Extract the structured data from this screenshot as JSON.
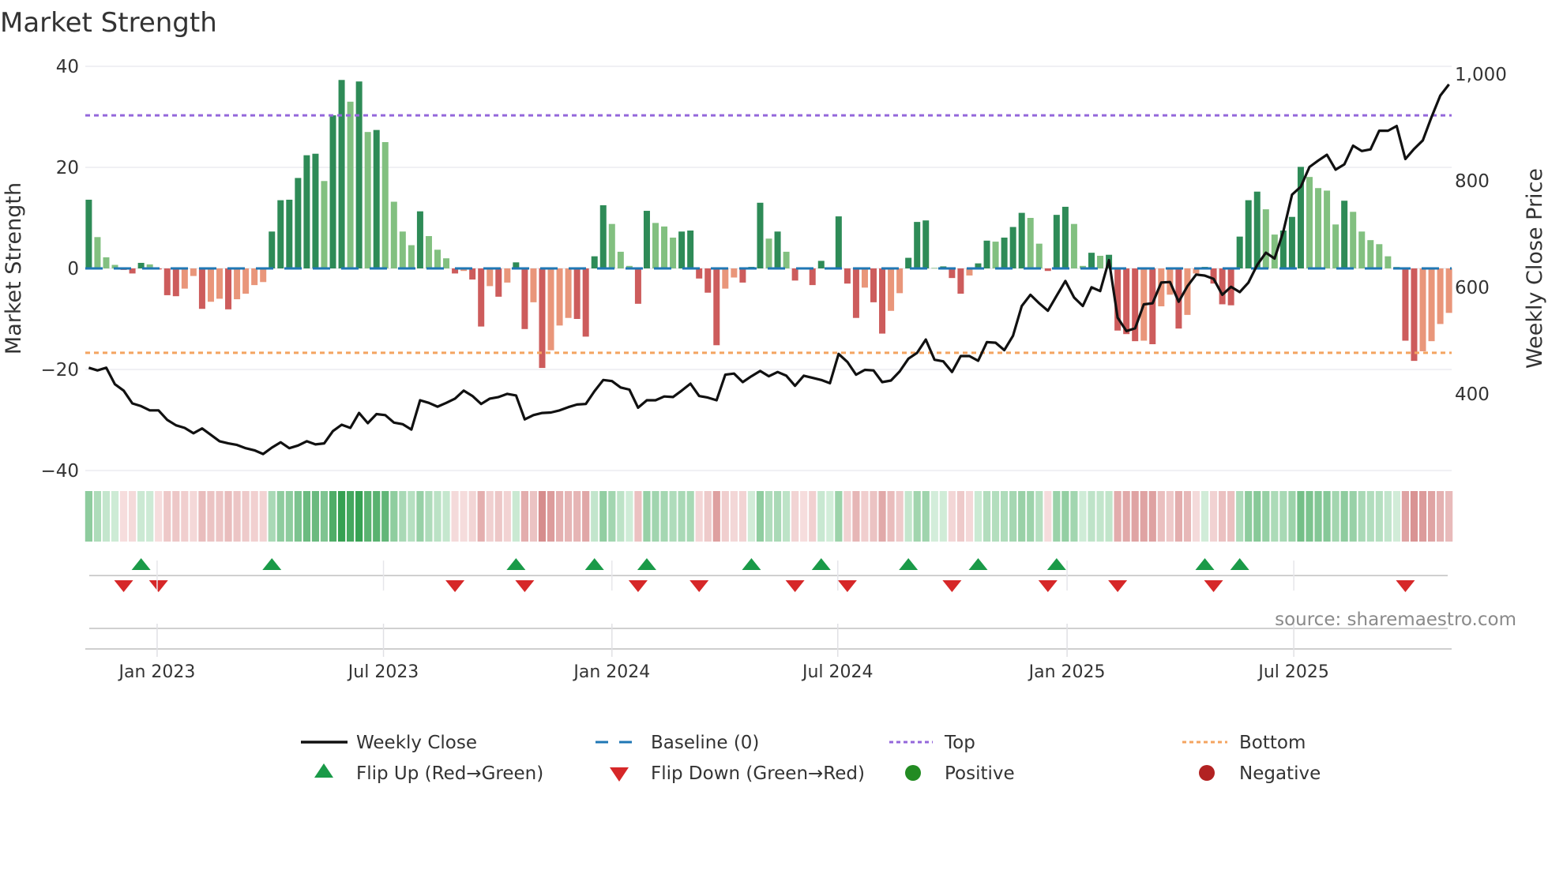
{
  "chart_data": {
    "type": "bar",
    "title": "Market Strength",
    "ylabel": "Market Strength",
    "ylabel_right": "Weekly Close Price",
    "ylim": [
      -40,
      40
    ],
    "ylim_right": [
      256,
      1015
    ],
    "yticks": [
      40,
      20,
      0,
      -20,
      -40
    ],
    "yticks_right": [
      1000,
      800,
      600,
      400
    ],
    "ytick_labels": [
      "40",
      "20",
      "0",
      "−20",
      "−40"
    ],
    "ytick_labels_right": [
      "1,000",
      "800",
      "600",
      "400"
    ],
    "xticks": [
      {
        "label": "Jan 2023",
        "x_index": 7.84
      },
      {
        "label": "Jul 2023",
        "x_index": 33.8
      },
      {
        "label": "Jan 2024",
        "x_index": 60.0
      },
      {
        "label": "Jul 2024",
        "x_index": 85.9
      },
      {
        "label": "Jan 2025",
        "x_index": 112.2
      },
      {
        "label": "Jul 2025",
        "x_index": 138.2
      }
    ],
    "grid": true,
    "top_level": 30.3,
    "bottom_level": -16.7,
    "strength": [
      13.6,
      6.2,
      2.2,
      0.7,
      -0.3,
      -1.0,
      1.1,
      0.8,
      -0.2,
      -5.3,
      -5.5,
      -4,
      -1.5,
      -8,
      -6.6,
      -6,
      -8.1,
      -6.1,
      -5,
      -3.3,
      -2.7,
      7.3,
      13.5,
      13.6,
      17.9,
      22.4,
      22.7,
      17.3,
      30.3,
      37.3,
      33,
      37,
      27,
      27.4,
      25,
      13.2,
      7.3,
      4.6,
      11.3,
      6.4,
      3.7,
      2,
      -1,
      -0.5,
      -2.2,
      -11.5,
      -3.5,
      -5.6,
      -2.8,
      1.2,
      -12,
      -6.7,
      -19.7,
      -16.2,
      -11.3,
      -9.8,
      -10,
      -13.5,
      2.4,
      12.5,
      8.8,
      3.3,
      0.5,
      -7,
      11.4,
      9,
      8.3,
      6.1,
      7.3,
      7.5,
      -2,
      -4.8,
      -15.2,
      -4,
      -1.8,
      -2.8,
      0.3,
      13,
      5.9,
      7.3,
      3.3,
      -2.4,
      -0.2,
      -3.3,
      1.5,
      0.2,
      10.3,
      -3,
      -9.8,
      -3.8,
      -6.7,
      -12.9,
      -8.4,
      -4.9,
      2.1,
      9.2,
      9.5,
      0.1,
      0.4,
      -1.9,
      -5,
      -1.4,
      1,
      5.5,
      5.3,
      6.1,
      8.2,
      11,
      10,
      4.9,
      -0.5,
      10.6,
      12.2,
      8.8,
      0.5,
      3.1,
      2.5,
      2.7,
      -12.3,
      -13,
      -14.4,
      -14.3,
      -15,
      -7.5,
      -5.2,
      -11.9,
      -9.2,
      -1,
      0.3,
      -3,
      -7.1,
      -7.3,
      6.3,
      13.5,
      15.2,
      11.7,
      6.7,
      7.5,
      10.2,
      20.1,
      18.1,
      15.9,
      15.4,
      8.7,
      13.4,
      11.2,
      7.3,
      5.6,
      4.8,
      2.4,
      0.3,
      -14.3,
      -18.3,
      -16.4,
      -14.4,
      -11,
      -8.8
    ],
    "weekly_close": [
      449,
      444,
      449,
      418,
      406,
      382,
      377,
      369,
      369,
      351,
      341,
      336,
      326,
      335,
      323,
      311,
      307,
      304,
      298,
      294,
      287,
      299,
      309,
      298,
      303,
      311,
      305,
      307,
      330,
      342,
      336,
      364,
      345,
      362,
      360,
      346,
      343,
      333,
      388,
      383,
      376,
      383,
      391,
      406,
      396,
      381,
      391,
      394,
      400,
      397,
      352,
      360,
      364,
      365,
      369,
      375,
      380,
      381,
      405,
      426,
      424,
      412,
      408,
      374,
      388,
      388,
      395,
      394,
      406,
      419,
      396,
      393,
      388,
      436,
      438,
      422,
      433,
      443,
      433,
      441,
      434,
      415,
      434,
      430,
      426,
      420,
      475,
      460,
      436,
      445,
      444,
      422,
      425,
      442,
      466,
      477,
      502,
      464,
      461,
      441,
      471,
      471,
      462,
      497,
      496,
      482,
      509,
      565,
      586,
      570,
      556,
      584,
      612,
      581,
      565,
      600,
      593,
      651,
      543,
      518,
      523,
      568,
      570,
      609,
      610,
      573,
      602,
      624,
      622,
      616,
      586,
      601,
      591,
      609,
      642,
      665,
      654,
      705,
      774,
      789,
      826,
      838,
      849,
      821,
      831,
      866,
      856,
      859,
      894,
      894,
      903,
      841,
      860,
      876,
      920,
      960,
      981
    ],
    "flip_up_indices": [
      6,
      21,
      49,
      58,
      64,
      76,
      84,
      94,
      102,
      111,
      128,
      132
    ],
    "flip_down_indices": [
      4,
      8,
      42,
      50,
      63,
      70,
      81,
      87,
      99,
      110,
      118,
      129,
      151
    ],
    "legend": {
      "placement": "bottom",
      "entries": [
        "Weekly Close",
        "Baseline (0)",
        "Top",
        "Bottom",
        "Flip Up (Red→Green)",
        "Flip Down (Green→Red)",
        "Positive",
        "Negative"
      ]
    },
    "source_note": "source: sharemaestro.com"
  },
  "colors": {
    "rising_positive": "#2e8b57",
    "falling_positive": "#82c080",
    "falling_negative": "#cd5c5c",
    "rising_negative": "#e9967a",
    "baseline": "#1f77b4",
    "top": "#9467db",
    "bottom": "#f4a460",
    "line": "#111111",
    "flip_up": "#1a9a48",
    "flip_down": "#d62728",
    "positive": "#228b22",
    "negative": "#b22222"
  }
}
